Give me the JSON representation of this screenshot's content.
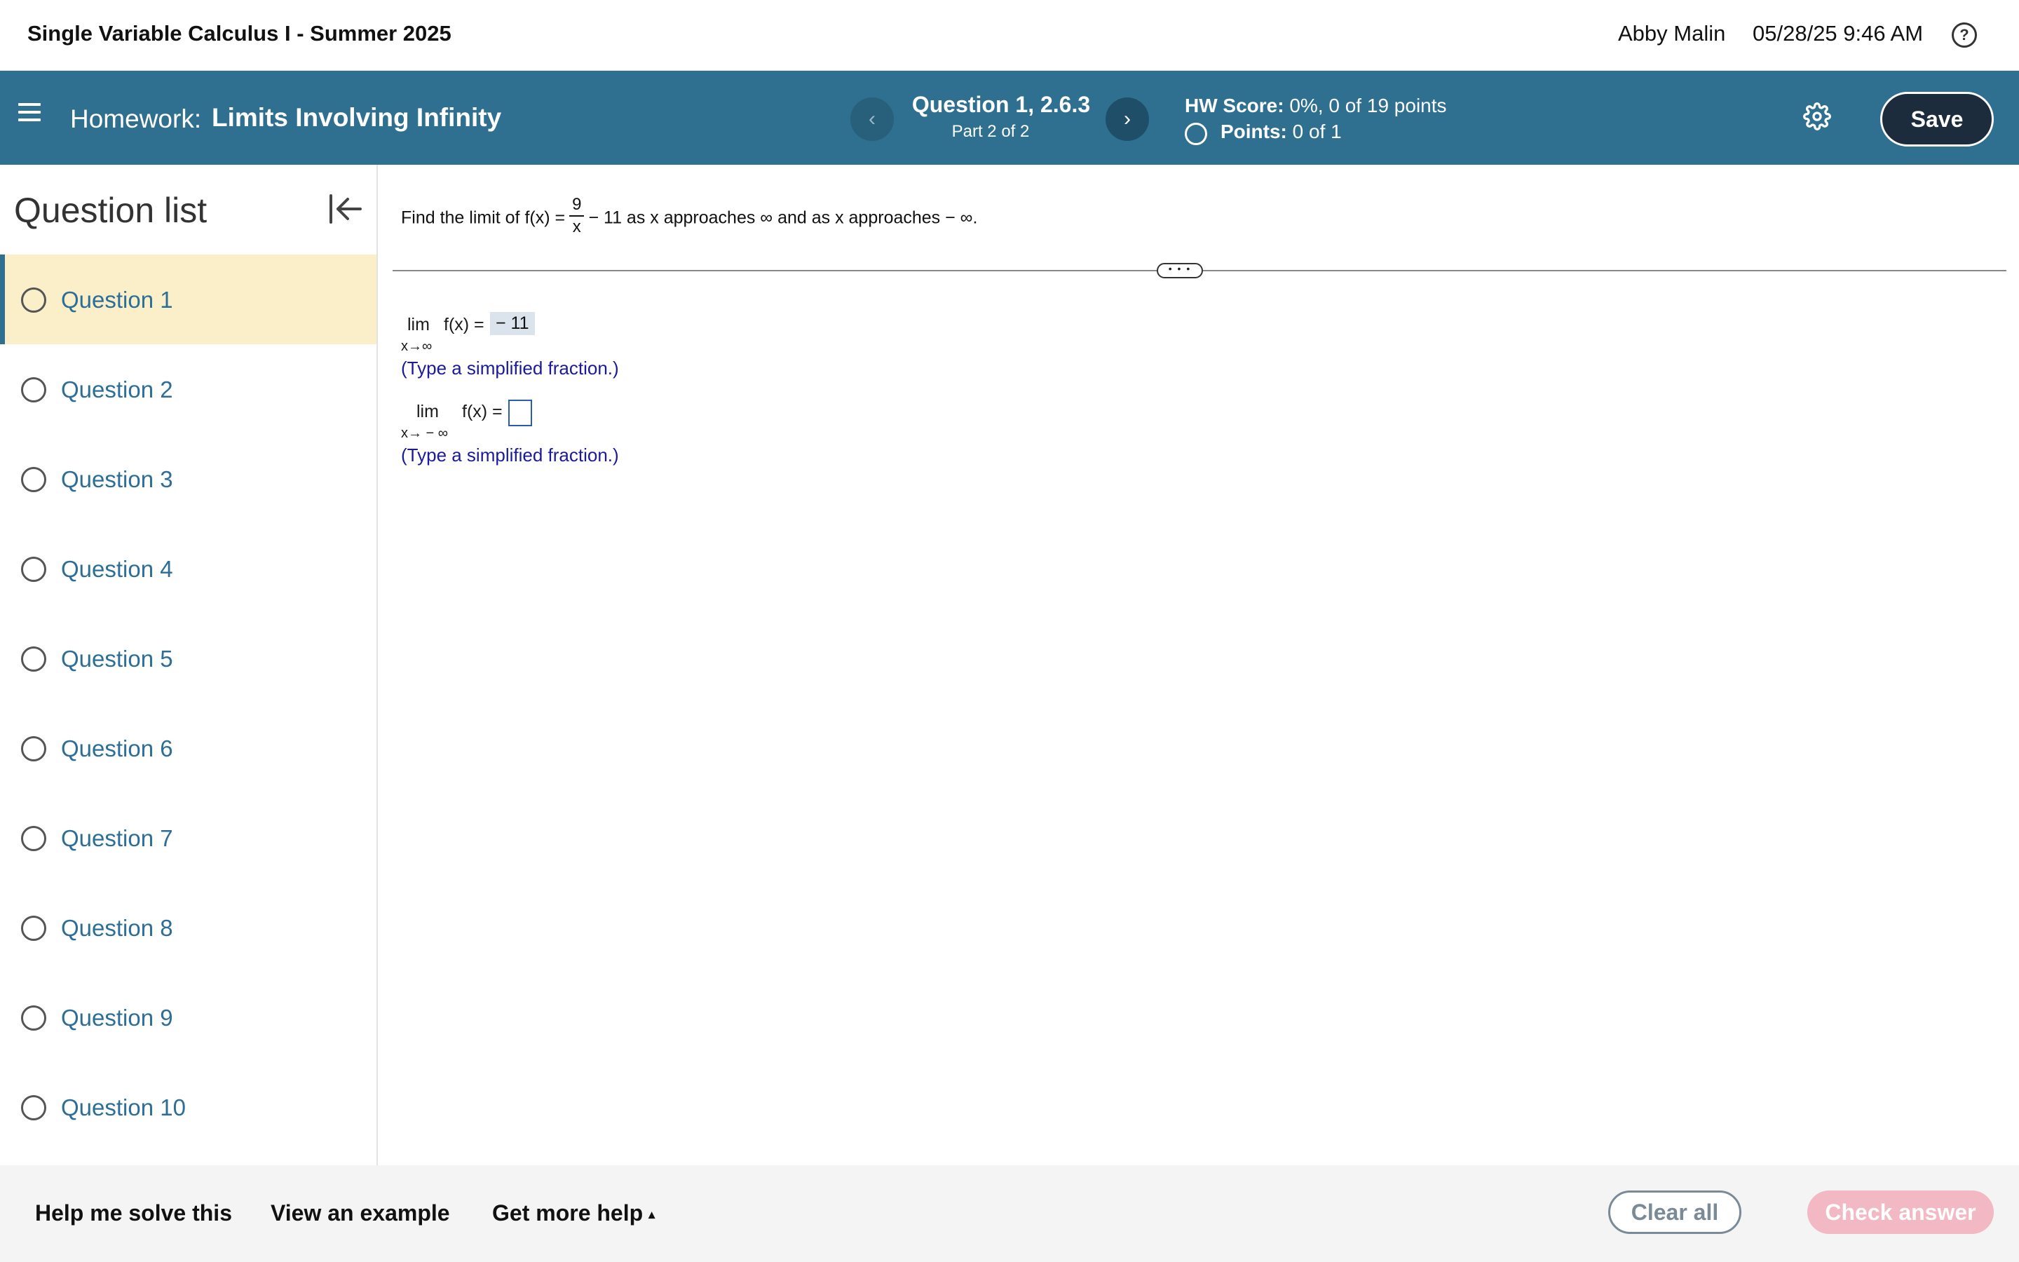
{
  "topbar": {
    "course_title": "Single Variable Calculus I - Summer 2025",
    "user_name": "Abby Malin",
    "datetime": "05/28/25 9:46 AM",
    "help_icon": "?"
  },
  "header": {
    "homework_prefix": "Homework:",
    "homework_name": "Limits Involving Infinity",
    "prev_icon": "‹",
    "next_icon": "›",
    "question_title": "Question 1, 2.6.3",
    "question_part": "Part 2 of 2",
    "hw_score_label": "HW Score:",
    "hw_score_value": "0%, 0 of 19 points",
    "points_label": "Points:",
    "points_value": "0 of 1",
    "save_label": "Save"
  },
  "sidebar": {
    "title": "Question list",
    "items": [
      {
        "label": "Question 1"
      },
      {
        "label": "Question 2"
      },
      {
        "label": "Question 3"
      },
      {
        "label": "Question 4"
      },
      {
        "label": "Question 5"
      },
      {
        "label": "Question 6"
      },
      {
        "label": "Question 7"
      },
      {
        "label": "Question 8"
      },
      {
        "label": "Question 9"
      },
      {
        "label": "Question 10"
      }
    ]
  },
  "problem": {
    "prefix": "Find the limit of f(x) =",
    "frac_num": "9",
    "frac_den": "x",
    "suffix": "− 11 as x approaches ∞ and as x approaches  − ∞."
  },
  "divider_handle": "• • •",
  "answers": {
    "lim_word": "lim",
    "fx_label": "f(x) =",
    "pos_sub": "x→∞",
    "pos_value": "− 11",
    "pos_hint": "(Type a simplified fraction.)",
    "neg_sub": "x→ − ∞",
    "neg_value": "",
    "neg_hint": "(Type a simplified fraction.)"
  },
  "bottombar": {
    "help_solve": "Help me solve this",
    "view_example": "View an example",
    "more_help": "Get more help",
    "more_caret": "▴",
    "clear_all": "Clear all",
    "check_answer": "Check answer"
  },
  "colors": {
    "header_bg": "#2f6f8f",
    "active_item_bg": "#faefc8",
    "link_blue": "#2c6e97",
    "hint_blue": "#1a1a9a",
    "check_button": "#f2b9c4"
  }
}
